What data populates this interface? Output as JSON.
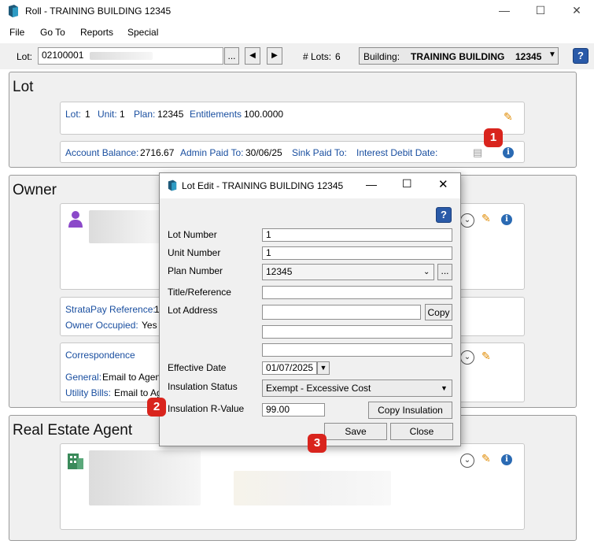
{
  "window": {
    "title": "Roll - TRAINING BUILDING 12345",
    "minimize": "—",
    "maximize": "☐",
    "close": "✕"
  },
  "menu": [
    "File",
    "Go To",
    "Reports",
    "Special"
  ],
  "toolbar": {
    "lot_label": "Lot:",
    "lot_value": "02100001",
    "browse": "...",
    "prev": "◀",
    "next": "▶",
    "num_lots_label": "# Lots:",
    "num_lots_value": "6",
    "building_label": "Building:",
    "building_value": "TRAINING BUILDING",
    "building_number": "12345",
    "help": "?"
  },
  "lot_section": {
    "title": "Lot",
    "lot_label": "Lot:",
    "lot_value": "1",
    "unit_label": "Unit:",
    "unit_value": "1",
    "plan_label": "Plan:",
    "plan_value": "12345",
    "ent_label": "Entitlements",
    "ent_value": "100.0000",
    "acct_label": "Account Balance:",
    "acct_value": "2716.67",
    "admin_label": "Admin Paid To:",
    "admin_value": "30/06/25",
    "sink_label": "Sink Paid To:",
    "interest_label": "Interest Debit Date:"
  },
  "owner_section": {
    "title": "Owner",
    "stratapay_label": "StrataPay Reference:",
    "stratapay_value": "1",
    "occupied_label": "Owner Occupied:",
    "occupied_value": "Yes",
    "correspondence_label": "Correspondence",
    "general_label": "General:",
    "general_value": "Email to Agen",
    "utility_label": "Utility Bills:",
    "utility_value": "Email to Ag"
  },
  "agent_section": {
    "title": "Real Estate Agent"
  },
  "badges": {
    "b1": "1",
    "b2": "2",
    "b3": "3"
  },
  "dialog": {
    "title": "Lot Edit - TRAINING BUILDING 12345",
    "help": "?",
    "lot_number_label": "Lot Number",
    "lot_number_value": "1",
    "unit_number_label": "Unit Number",
    "unit_number_value": "1",
    "plan_number_label": "Plan Number",
    "plan_number_value": "12345",
    "plan_browse": "...",
    "title_ref_label": "Title/Reference",
    "title_ref_value": "",
    "lot_address_label": "Lot Address",
    "lot_address_value": "",
    "copy_button": "Copy",
    "effective_date_label": "Effective Date",
    "effective_date_value": "01/07/2025",
    "insulation_status_label": "Insulation Status",
    "insulation_status_value": "Exempt - Excessive Cost",
    "insulation_r_label": "Insulation R-Value",
    "insulation_r_value": "99.00",
    "copy_insulation_button": "Copy Insulation",
    "save_button": "Save",
    "close_button": "Close"
  }
}
